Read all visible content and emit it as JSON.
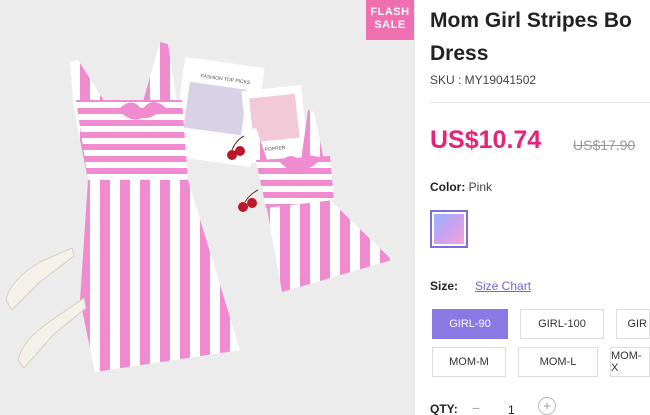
{
  "badge": {
    "line1": "FLASH",
    "line2": "SALE"
  },
  "product": {
    "title_line1": "Mom Girl Stripes Bo",
    "title_line2": "Dress",
    "sku": "SKU : MY19041502",
    "price": "US$10.74",
    "old_price": "US$17.90"
  },
  "color": {
    "label": "Color:",
    "value": "Pink"
  },
  "size": {
    "label": "Size:",
    "chart_link": "Size Chart",
    "options": [
      "GIRL-90",
      "GIRL-100",
      "GIR",
      "MOM-M",
      "MOM-L",
      "MOM-X"
    ],
    "selected": "GIRL-90"
  },
  "quantity": {
    "label": "QTY:",
    "minus": "−",
    "value": "1",
    "plus": "+"
  },
  "image_text": {
    "card1": "FASHION TOP PICKS",
    "card2": "POPPER"
  },
  "colors": {
    "accent": "#8a79e3",
    "price": "#e4237a",
    "badge": "#f06fb0",
    "stripe": "#f08bd0"
  }
}
